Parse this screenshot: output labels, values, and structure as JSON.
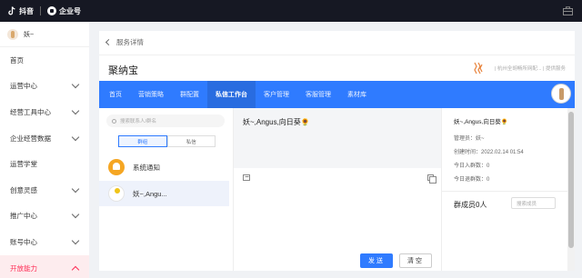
{
  "topbar": {
    "brand1": "抖音",
    "brand2": "企业号"
  },
  "sidebar": {
    "user_name": "妖~",
    "items": [
      {
        "label": "首页",
        "has_chevron": false
      },
      {
        "label": "运营中心",
        "has_chevron": true
      },
      {
        "label": "经营工具中心",
        "has_chevron": true
      },
      {
        "label": "企业经营数据",
        "has_chevron": true
      },
      {
        "label": "运营学堂",
        "has_chevron": false
      },
      {
        "label": "创意灵感",
        "has_chevron": true
      },
      {
        "label": "推广中心",
        "has_chevron": true
      },
      {
        "label": "账号中心",
        "has_chevron": true
      },
      {
        "label": "开放能力",
        "has_chevron": true
      }
    ]
  },
  "breadcrumb": {
    "label": "服务详情"
  },
  "page": {
    "title": "聚纳宝",
    "provider_text": "| 杭州全胡畅所网配... | 提供服务"
  },
  "tabs": [
    "首页",
    "营销策略",
    "群配置",
    "私信工作台",
    "客户管理",
    "客服管理",
    "素材库"
  ],
  "contacts": {
    "search_placeholder": "搜索联系人/群名",
    "seg_group": "群组",
    "seg_private": "私信",
    "items": [
      {
        "name": "系统通知"
      },
      {
        "name": "妖~,Angu..."
      }
    ]
  },
  "conversation": {
    "title": "妖~,Angus,向日葵🌻",
    "send_label": "发送",
    "clear_label": "清空"
  },
  "info": {
    "name": "妖~,Angus,向日葵🌻",
    "manager": "管理员：妖~",
    "created": "创建时间：2022.02.14 01:54",
    "joined_today": "今日入群数：0",
    "left_today": "今日退群数：0",
    "members": "群成员0人",
    "member_search_placeholder": "搜索成员"
  },
  "colors": {
    "accent": "#2f7bff",
    "brand_red": "#fe2c55",
    "topbar": "#161823"
  }
}
